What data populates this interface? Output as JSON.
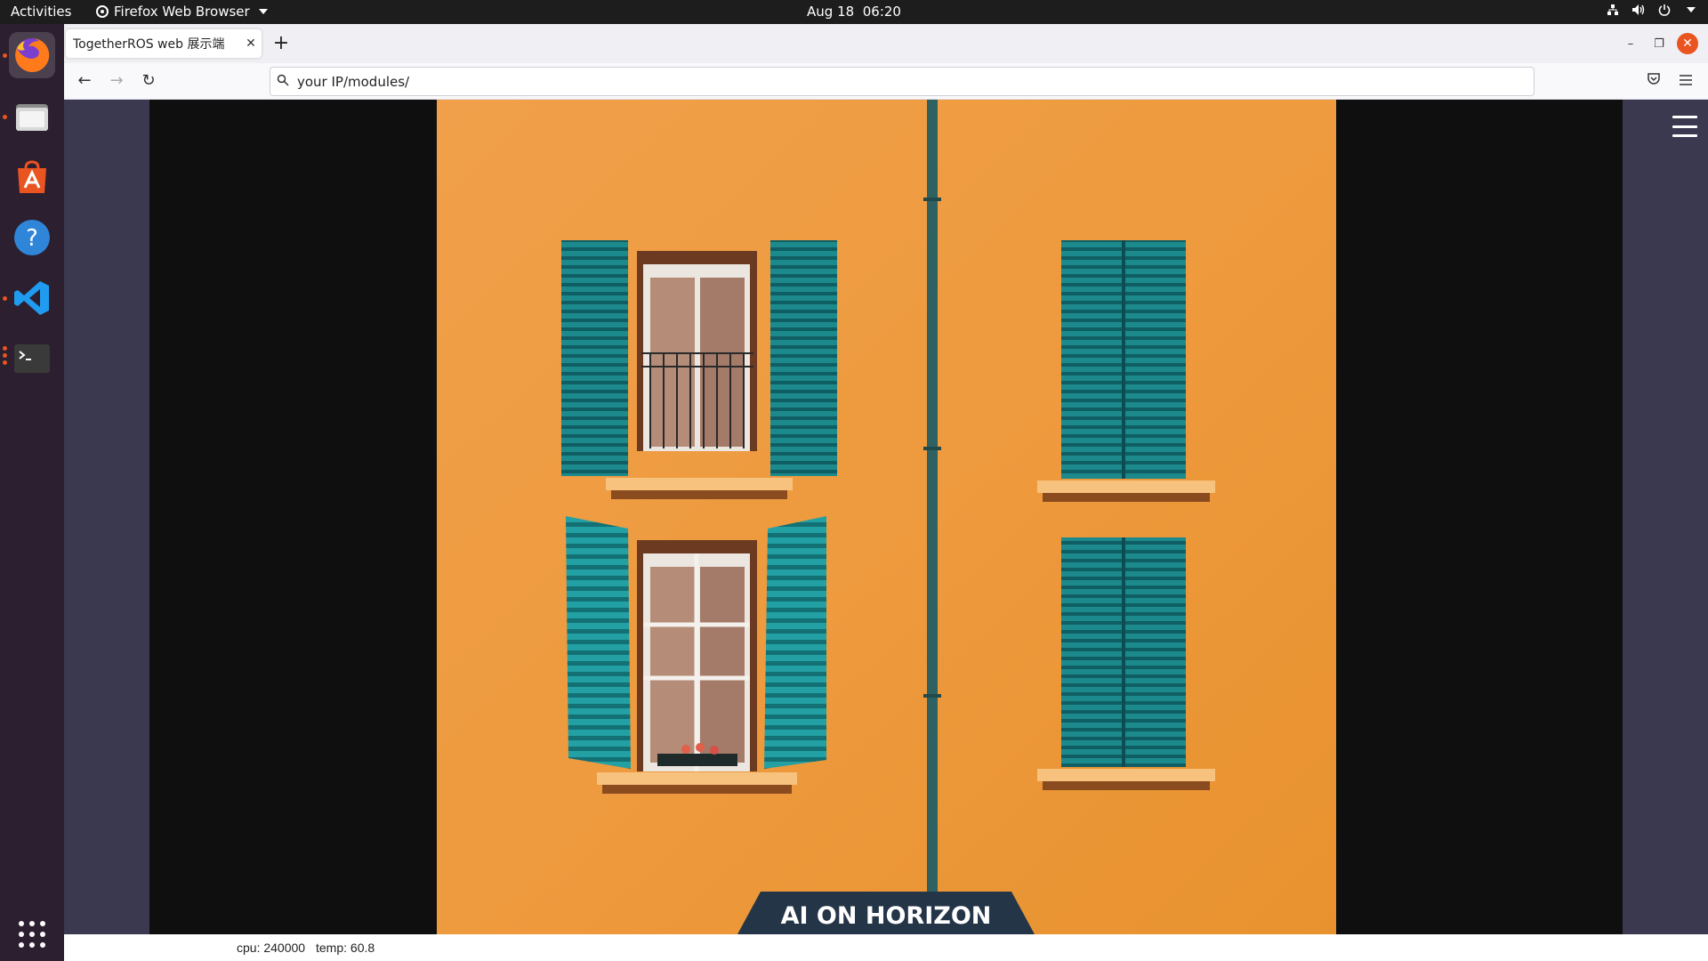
{
  "topbar": {
    "activities": "Activities",
    "app_name": "Firefox Web Browser",
    "date": "Aug 18",
    "time": "06:20"
  },
  "dock": {
    "items": [
      {
        "name": "firefox",
        "icon": "firefox-icon",
        "active": true,
        "running": true
      },
      {
        "name": "files",
        "icon": "files-icon",
        "running": true
      },
      {
        "name": "software",
        "icon": "app-center-icon"
      },
      {
        "name": "help",
        "icon": "help-icon"
      },
      {
        "name": "vscode",
        "icon": "vscode-icon",
        "running": true
      },
      {
        "name": "terminal",
        "icon": "terminal-icon",
        "running": true
      }
    ],
    "show_apps_icon": "grid-icon"
  },
  "browser": {
    "tab_title": "TogetherROS web 展示端",
    "url": "your IP/modules/"
  },
  "page": {
    "logo_text": "AI ON HORIZON",
    "status": {
      "cpu": "cpu: 240000",
      "temp": "temp: 60.8"
    }
  },
  "colors": {
    "accent": "#e95420",
    "wall": "#ee9a3e",
    "shutter": "#1c8a8c",
    "sidebar": "#3b394f"
  }
}
